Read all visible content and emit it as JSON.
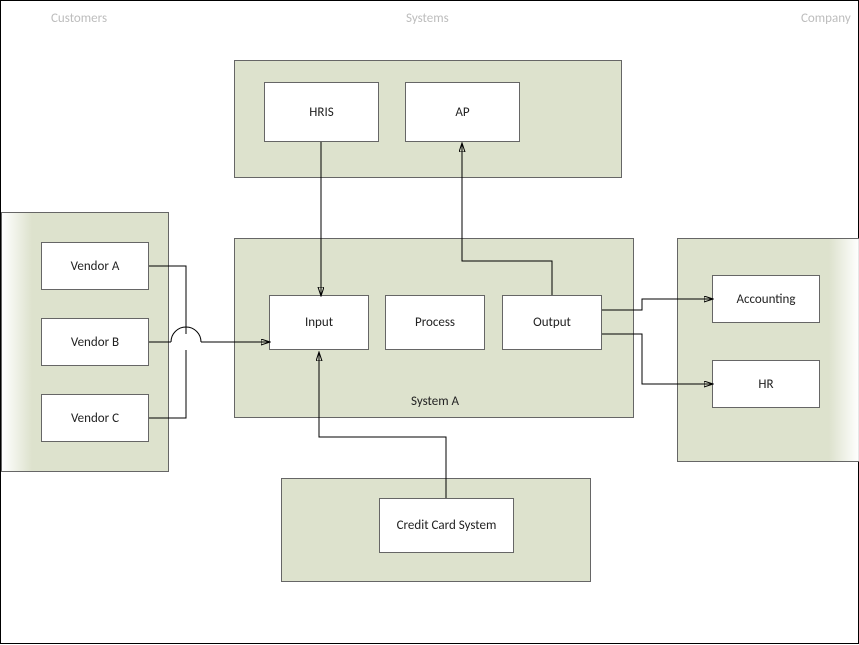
{
  "headers": {
    "left": "Customers",
    "center": "Systems",
    "right": "Company"
  },
  "groups": {
    "top": {
      "label": ""
    },
    "left": {
      "label": ""
    },
    "center": {
      "label": "System A"
    },
    "right": {
      "label": ""
    },
    "bottom": {
      "label": ""
    }
  },
  "nodes": {
    "hris": "HRIS",
    "ap": "AP",
    "vendor_a": "Vendor A",
    "vendor_b": "Vendor B",
    "vendor_c": "Vendor C",
    "input": "Input",
    "process": "Process",
    "output": "Output",
    "accounting": "Accounting",
    "hr": "HR",
    "credit_card": "Credit Card System"
  }
}
